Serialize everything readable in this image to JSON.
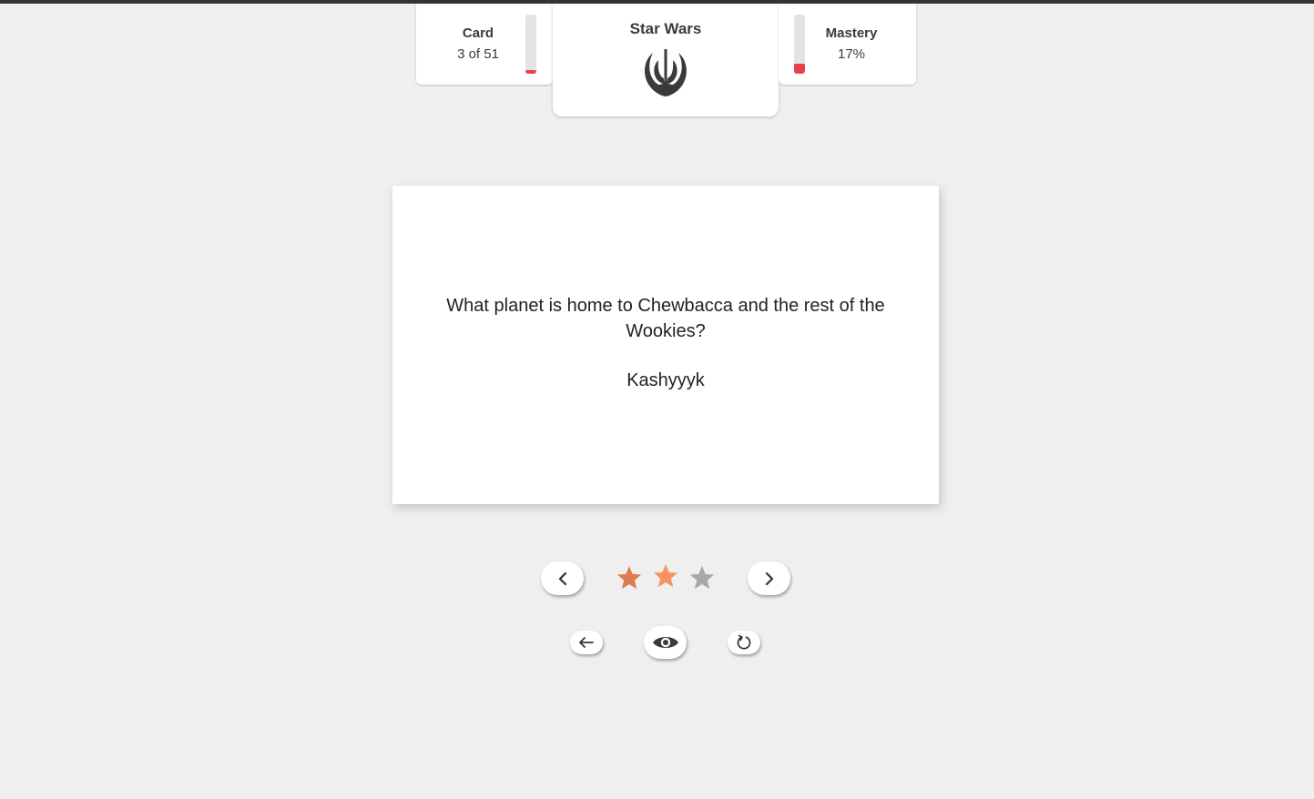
{
  "stats": {
    "card": {
      "label": "Card",
      "value": "3 of 51",
      "progress_fraction": 0.0588
    },
    "mastery": {
      "label": "Mastery",
      "value": "17%",
      "progress_fraction": 0.17
    }
  },
  "deck": {
    "title": "Star Wars",
    "logo_icon": "jedi-order-icon"
  },
  "flashcard": {
    "question": "What planet is home to Chewbacca and the rest of the Wookies?",
    "answer": "Kashyyyk"
  },
  "rating": {
    "stars_total": 3,
    "stars_filled": 2,
    "colors": {
      "star1": "#e07a4f",
      "star2": "#f4955f",
      "star_empty": "#a8a8a8"
    }
  },
  "controls": {
    "prev_icon": "chevron-left-icon",
    "next_icon": "chevron-right-icon",
    "back_icon": "arrow-left-icon",
    "show_icon": "eye-icon",
    "reset_icon": "refresh-icon"
  },
  "colors": {
    "accent_red": "#e8414a",
    "background": "#efefef",
    "text": "#3a3a3a"
  }
}
